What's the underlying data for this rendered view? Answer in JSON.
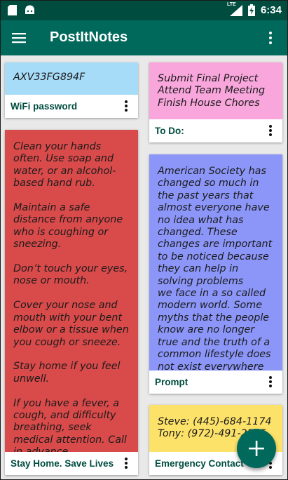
{
  "status_bar": {
    "time": "6:34",
    "network": "LTE",
    "icons": [
      "sd-card-icon",
      "android-icon",
      "signal-icon",
      "battery-charging-icon"
    ]
  },
  "app_bar": {
    "title": "PostItNotes",
    "menu_icon": "hamburger-menu-icon",
    "overflow_icon": "overflow-menu-icon"
  },
  "colors": {
    "status_bar": "#004d40",
    "app_bar": "#00695c",
    "label_text": "#004d40",
    "note_blue": "#a7dcf9",
    "note_red": "#d94a4a",
    "note_pink": "#f8a6dc",
    "note_periwinkle": "#8b96f8",
    "note_yellow": "#fde26a"
  },
  "notes": [
    {
      "label": "WiFi password",
      "color": "#a7dcf9",
      "text": "AXV33FG894F"
    },
    {
      "label": "To Do:",
      "color": "#f8a6dc",
      "text": "Submit Final Project\nAttend Team Meeting\nFinish House Chores"
    },
    {
      "label": "Stay Home. Save Lives",
      "color": "#d94a4a",
      "text": "Clean your hands often. Use soap and water, or an alcohol-based hand rub.\n\nMaintain a safe distance from anyone who is coughing or sneezing.\n\nDon’t touch your eyes, nose or mouth.\n\nCover your nose and mouth with your bent elbow or a tissue when you cough or sneeze.\n\nStay home if you feel unwell.\n\nIf you have a fever, a cough, and difficulty breathing, seek medical attention. Call in advance."
    },
    {
      "label": "Prompt",
      "color": "#8b96f8",
      "text": "American Society has changed so much in the past years that almost everyone have no idea what has changed. These changes are important to be noticed because they can help in solving problems\nwe face in a so called modern world. Some myths that the people know are no longer true and the truth of a common lifestyle does not exist everywhere"
    },
    {
      "label": "Emergency Contact",
      "color": "#fde26a",
      "text": "Steve: (445)-684-1174\nTony: (972)-491-2345"
    }
  ],
  "fab": {
    "icon": "plus-icon"
  }
}
